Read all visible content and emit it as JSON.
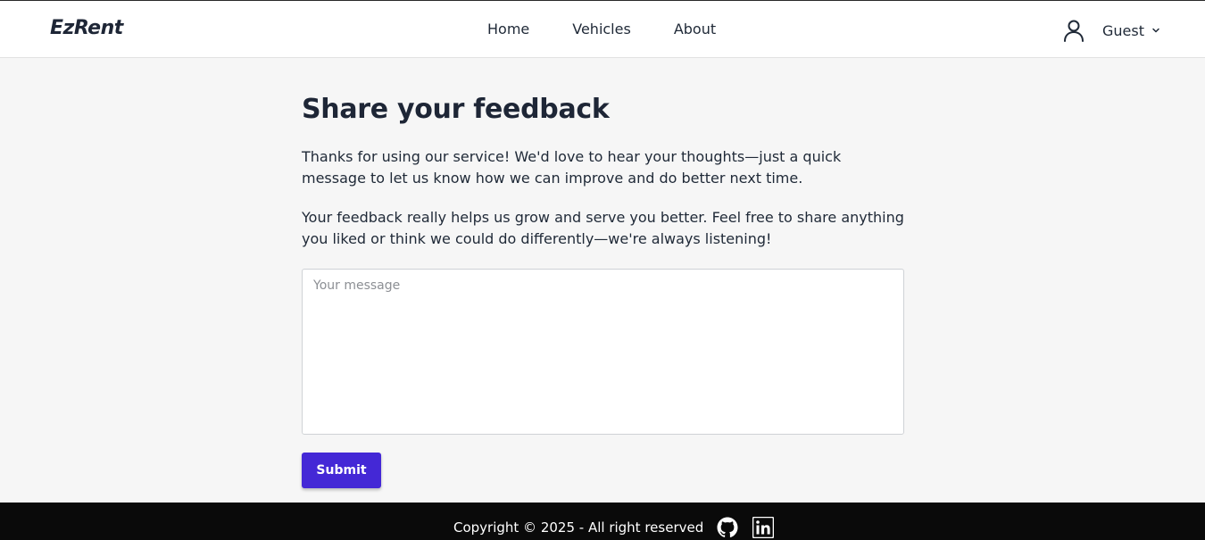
{
  "header": {
    "brand": "EzRent",
    "nav": [
      {
        "label": "Home"
      },
      {
        "label": "Vehicles"
      },
      {
        "label": "About"
      }
    ],
    "user": {
      "icon": "user-icon",
      "label": "Guest",
      "dropdown_icon": "chevron-down-icon"
    }
  },
  "main": {
    "title": "Share your feedback",
    "paragraph_1": "Thanks for using our service! We'd love to hear your thoughts—just a quick message to let us know how we can improve and do better next time.",
    "paragraph_2": "Your feedback really helps us grow and serve you better. Feel free to share anything you liked or think we could do differently—we're always listening!",
    "message": {
      "placeholder": "Your message",
      "value": ""
    },
    "submit_label": "Submit"
  },
  "footer": {
    "copyright": "Copyright © 2025 - All right reserved",
    "icons": [
      "github-icon",
      "linkedin-icon"
    ]
  },
  "colors": {
    "accent": "#4428d6",
    "background": "#f6f6f6",
    "header_bg": "#ffffff",
    "footer_bg": "#0a0a0a",
    "text": "#1f2937"
  }
}
